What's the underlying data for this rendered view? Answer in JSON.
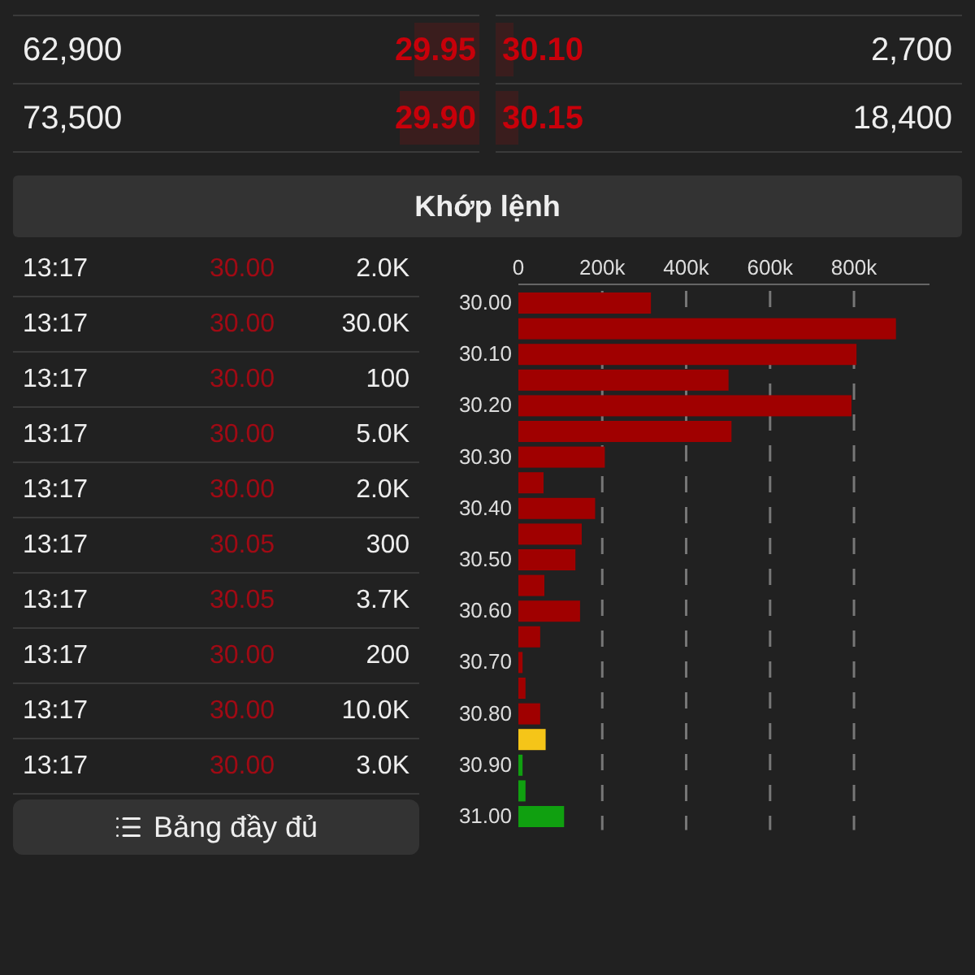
{
  "order_book": [
    {
      "bid_volume": "62,900",
      "bid_price": "29.95",
      "bid_depth": {
        "level": 0.14
      },
      "ask_price": "30.10",
      "ask_depth": {
        "level": 0.04
      },
      "ask_volume": "2,700"
    },
    {
      "bid_volume": "73,500",
      "bid_price": "29.90",
      "bid_depth": {
        "level": 0.17
      },
      "ask_price": "30.15",
      "ask_depth": {
        "level": 0.05
      },
      "ask_volume": "18,400"
    }
  ],
  "section_title": "Khớp lệnh",
  "trades": [
    {
      "time": "13:17",
      "price": "30.00",
      "volume": "2.0K"
    },
    {
      "time": "13:17",
      "price": "30.00",
      "volume": "30.0K"
    },
    {
      "time": "13:17",
      "price": "30.00",
      "volume": "100"
    },
    {
      "time": "13:17",
      "price": "30.00",
      "volume": "5.0K"
    },
    {
      "time": "13:17",
      "price": "30.00",
      "volume": "2.0K"
    },
    {
      "time": "13:17",
      "price": "30.05",
      "volume": "300"
    },
    {
      "time": "13:17",
      "price": "30.05",
      "volume": "3.7K"
    },
    {
      "time": "13:17",
      "price": "30.00",
      "volume": "200"
    },
    {
      "time": "13:17",
      "price": "30.00",
      "volume": "10.0K"
    },
    {
      "time": "13:17",
      "price": "30.00",
      "volume": "3.0K"
    }
  ],
  "full_table_button": "Bảng đầy đủ",
  "chart_data": {
    "type": "bar",
    "orientation": "horizontal",
    "grid": true,
    "categories": [
      "30.00",
      null,
      "30.10",
      null,
      "30.20",
      null,
      "30.30",
      null,
      "30.40",
      null,
      "30.50",
      null,
      "30.60",
      null,
      "30.70",
      null,
      "30.80",
      null,
      "30.90",
      null,
      "31.00"
    ],
    "series": [
      {
        "color": "#a00000",
        "values": [
          316000,
          900000,
          806000,
          501000,
          794000,
          508000,
          206000,
          60000,
          183000,
          151000,
          136000,
          62000,
          147000,
          52000,
          10000,
          17000,
          52000,
          null,
          null,
          null,
          null
        ]
      },
      {
        "color": "#f5c518",
        "values": [
          null,
          null,
          null,
          null,
          null,
          null,
          null,
          null,
          null,
          null,
          null,
          null,
          null,
          null,
          null,
          null,
          null,
          65000,
          null,
          null,
          null
        ]
      },
      {
        "color": "#10a010",
        "values": [
          null,
          null,
          null,
          null,
          null,
          null,
          null,
          null,
          null,
          null,
          null,
          null,
          null,
          null,
          null,
          null,
          null,
          null,
          10000,
          17000,
          109000
        ]
      }
    ],
    "xlim": [
      0,
      980000
    ],
    "xticks": [
      {
        "value": 0,
        "label": "0"
      },
      {
        "value": 200000,
        "label": "200k"
      },
      {
        "value": 400000,
        "label": "400k"
      },
      {
        "value": 600000,
        "label": "600k"
      },
      {
        "value": 800000,
        "label": "800k"
      }
    ]
  }
}
